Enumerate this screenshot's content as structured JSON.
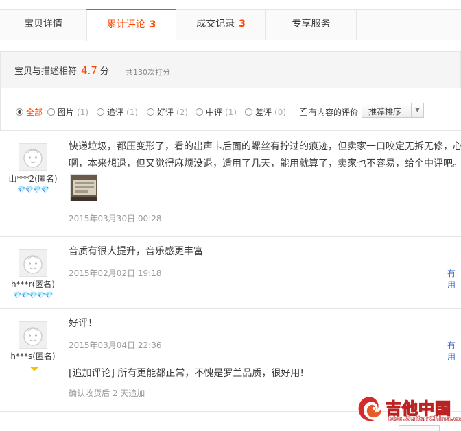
{
  "tabs": [
    {
      "label": "宝贝详情",
      "count": ""
    },
    {
      "label": "累计评论",
      "count": "3"
    },
    {
      "label": "成交记录",
      "count": "3"
    },
    {
      "label": "专享服务",
      "count": ""
    }
  ],
  "rating": {
    "desc_label": "宝贝与描述相符",
    "score": "4.7",
    "unit": "分",
    "total": "共130次打分"
  },
  "filters": [
    {
      "label": "全部",
      "count": ""
    },
    {
      "label": "图片",
      "count": "(1)"
    },
    {
      "label": "追评",
      "count": "(1)"
    },
    {
      "label": "好评",
      "count": "(2)"
    },
    {
      "label": "中评",
      "count": "(1)"
    },
    {
      "label": "差评",
      "count": "(0)"
    }
  ],
  "content_filter_label": "有内容的评价",
  "sort": {
    "selected": "推荐排序"
  },
  "reviews": [
    {
      "user": "山***2(匿名)",
      "rank": "hearts",
      "rank_level": 4,
      "content_line1": "快递垃圾，都压变形了，看的出声卡后面的螺丝有拧过的痕迹，但卖家一口咬定无拆无修，心",
      "content_line2": "啊，本来想退，但又觉得麻烦没退，适用了几天，能用就算了，卖家也不容易，给个中评吧。",
      "date": "2015年03月30日 00:28"
    },
    {
      "user": "h***r(匿名)",
      "rank": "hearts",
      "rank_level": 5,
      "content_line1": "音质有很大提升，音乐感更丰富",
      "date": "2015年02月02日 19:18",
      "useful": "有用"
    },
    {
      "user": "h***s(匿名)",
      "rank": "diamond",
      "rank_level": 1,
      "content_line1": "好评！",
      "date": "2015年03月04日 22:36",
      "useful": "有用",
      "append": "[追加评论] 所有更能都正常，不愧是罗兰品质，很好用!",
      "append_time": "确认收货后 2 天追加"
    }
  ],
  "watermark": {
    "text": "吉他中国",
    "url": "bbs.GuitarChina.com"
  },
  "colors": {
    "accent": "#ff4400",
    "link": "#3366cc",
    "muted": "#9a9a9a",
    "heart": "#e4393c",
    "diamond": "#f5c400"
  }
}
